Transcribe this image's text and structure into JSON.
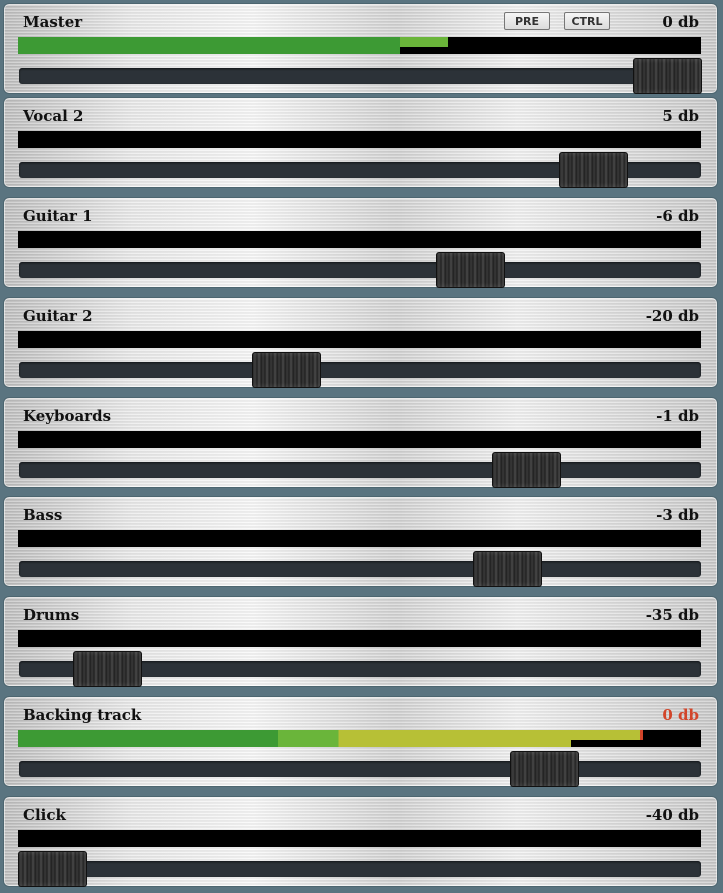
{
  "header_buttons": {
    "pre": "PRE",
    "ctrl": "CTRL"
  },
  "colors": {
    "meter_green": "#3d9a34",
    "meter_light_green": "#6ab53a",
    "meter_yellow": "#b7c036",
    "meter_red": "#d2452a",
    "clip_text": "#d2452a"
  },
  "channels": [
    {
      "name": "Master",
      "db": "0 db",
      "level": 0.56,
      "fader": 1.0,
      "peak": 0.63,
      "clip": false
    },
    {
      "name": "Vocal 2",
      "db": "5 db",
      "level": 0,
      "fader": 0.88,
      "peak": 0,
      "clip": false
    },
    {
      "name": "Guitar 1",
      "db": "-6 db",
      "level": 0,
      "fader": 0.68,
      "peak": 0,
      "clip": false
    },
    {
      "name": "Guitar 2",
      "db": "-20 db",
      "level": 0,
      "fader": 0.38,
      "peak": 0,
      "clip": false
    },
    {
      "name": "Keyboards",
      "db": "-1 db",
      "level": 0,
      "fader": 0.77,
      "peak": 0,
      "clip": false
    },
    {
      "name": "Bass",
      "db": "-3 db",
      "level": 0,
      "fader": 0.74,
      "peak": 0,
      "clip": false
    },
    {
      "name": "Drums",
      "db": "-35 db",
      "level": 0,
      "fader": 0.09,
      "peak": 0,
      "clip": false
    },
    {
      "name": "Backing track",
      "db": "0 db",
      "level": 0.81,
      "fader": 0.8,
      "peak": 0.91,
      "clip": true
    },
    {
      "name": "Click",
      "db": "-40 db",
      "level": 0,
      "fader": 0.0,
      "peak": 0,
      "clip": false
    }
  ]
}
